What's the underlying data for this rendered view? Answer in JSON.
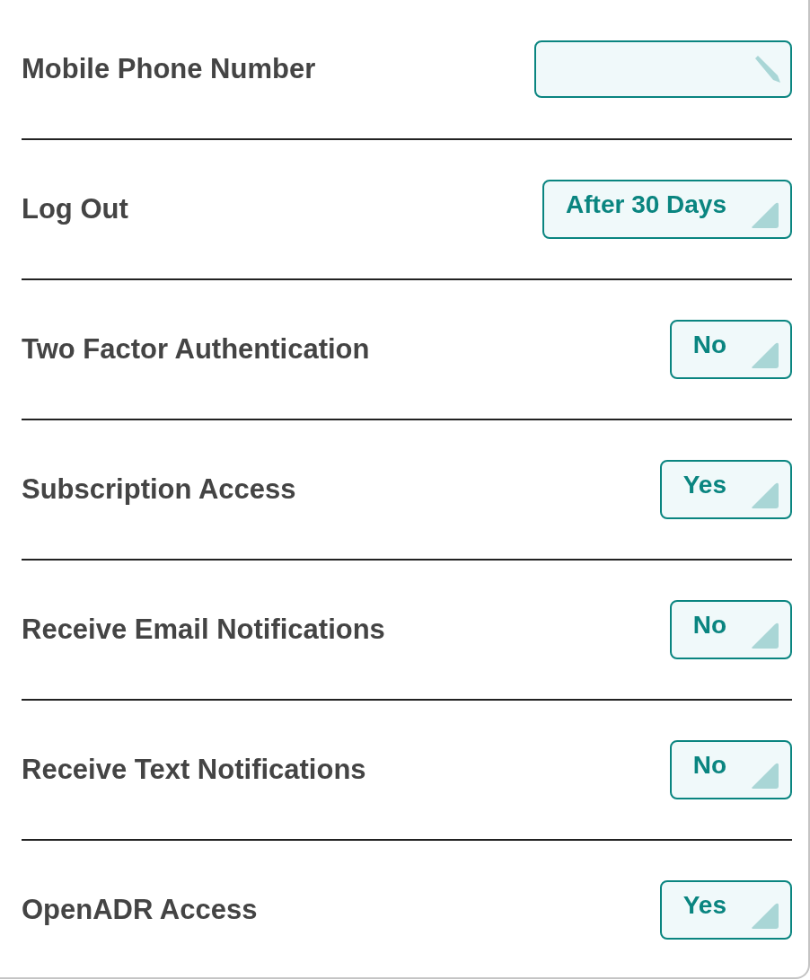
{
  "settings": [
    {
      "label": "Mobile Phone Number",
      "kind": "input"
    },
    {
      "label": "Log Out",
      "kind": "select",
      "value": "After 30 Days"
    },
    {
      "label": "Two Factor Authentication",
      "kind": "select",
      "value": "No"
    },
    {
      "label": "Subscription Access",
      "kind": "select",
      "value": "Yes"
    },
    {
      "label": "Receive Email Notifications",
      "kind": "select",
      "value": "No"
    },
    {
      "label": "Receive Text Notifications",
      "kind": "select",
      "value": "No"
    },
    {
      "label": "OpenADR Access",
      "kind": "select",
      "value": "Yes"
    }
  ]
}
